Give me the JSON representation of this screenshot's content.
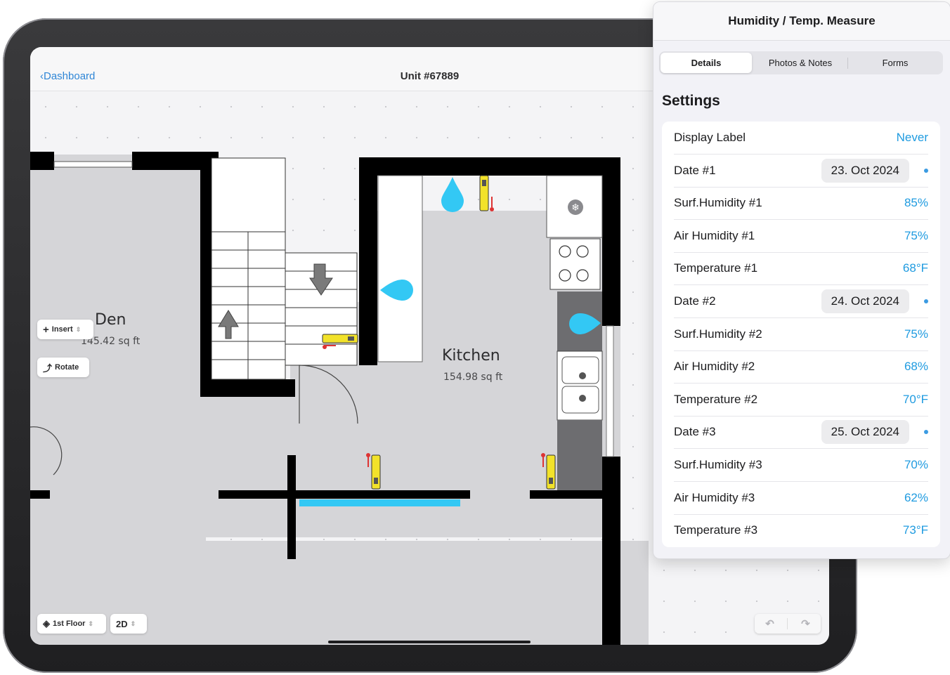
{
  "nav": {
    "back_label": "Dashboard",
    "title": "Unit #67889"
  },
  "rooms": [
    {
      "name": "Den",
      "area": "145.42 sq ft"
    },
    {
      "name": "Kitchen",
      "area": "154.98 sq ft"
    }
  ],
  "tools": {
    "insert_label": "Insert",
    "rotate_label": "Rotate",
    "floor_label": "1st Floor",
    "view_label": "2D"
  },
  "colors": {
    "water": "#33c8f4",
    "sensor": "#f2e22a",
    "wall": "#000000"
  },
  "panel": {
    "title": "Humidity / Temp. Measure",
    "tabs": [
      {
        "label": "Details",
        "active": true
      },
      {
        "label": "Photos & Notes",
        "active": false
      },
      {
        "label": "Forms",
        "active": false
      }
    ],
    "section_title": "Settings",
    "rows": [
      {
        "label": "Display Label",
        "value": "Never"
      },
      {
        "label": "Date #1",
        "value": "23. Oct 2024"
      },
      {
        "label": "Surf.Humidity #1",
        "value": "85%"
      },
      {
        "label": "Air Humidity #1",
        "value": "75%"
      },
      {
        "label": "Temperature #1",
        "value": "68°F"
      },
      {
        "label": "Date #2",
        "value": "24. Oct 2024"
      },
      {
        "label": "Surf.Humidity #2",
        "value": "75%"
      },
      {
        "label": "Air Humidity #2",
        "value": "68%"
      },
      {
        "label": "Temperature #2",
        "value": "70°F"
      },
      {
        "label": "Date #3",
        "value": "25. Oct 2024"
      },
      {
        "label": "Surf.Humidity #3",
        "value": "70%"
      },
      {
        "label": "Air Humidity #3",
        "value": "62%"
      },
      {
        "label": "Temperature #3",
        "value": "73°F"
      }
    ]
  }
}
